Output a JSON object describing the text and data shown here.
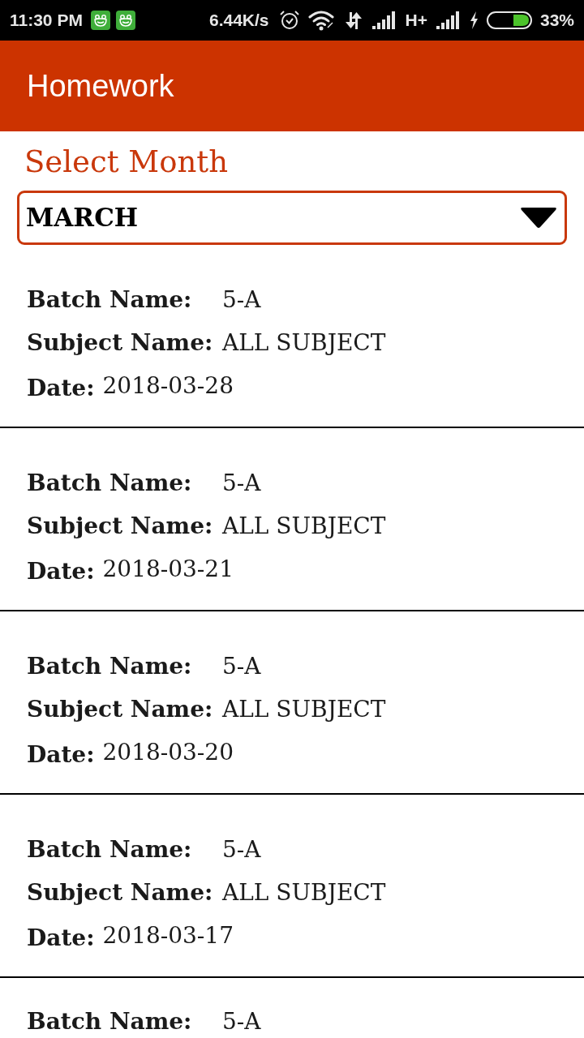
{
  "status_bar": {
    "time": "11:30 PM",
    "network_speed": "6.44K/s",
    "network_type": "H+",
    "battery": "33%"
  },
  "app_bar": {
    "title": "Homework"
  },
  "month_select": {
    "label": "Select Month",
    "value": "MARCH"
  },
  "entries": [
    {
      "batch_label": "Batch Name:",
      "batch": "5-A",
      "subject_label": "Subject Name:",
      "subject": "ALL SUBJECT",
      "date_label": "Date:",
      "date": "2018-03-28"
    },
    {
      "batch_label": "Batch Name:",
      "batch": "5-A",
      "subject_label": "Subject Name:",
      "subject": "ALL SUBJECT",
      "date_label": "Date:",
      "date": "2018-03-21"
    },
    {
      "batch_label": "Batch Name:",
      "batch": "5-A",
      "subject_label": "Subject Name:",
      "subject": "ALL SUBJECT",
      "date_label": "Date:",
      "date": "2018-03-20"
    },
    {
      "batch_label": "Batch Name:",
      "batch": "5-A",
      "subject_label": "Subject Name:",
      "subject": "ALL SUBJECT",
      "date_label": "Date:",
      "date": "2018-03-17"
    },
    {
      "batch_label": "Batch Name:",
      "batch": "5-A"
    }
  ]
}
